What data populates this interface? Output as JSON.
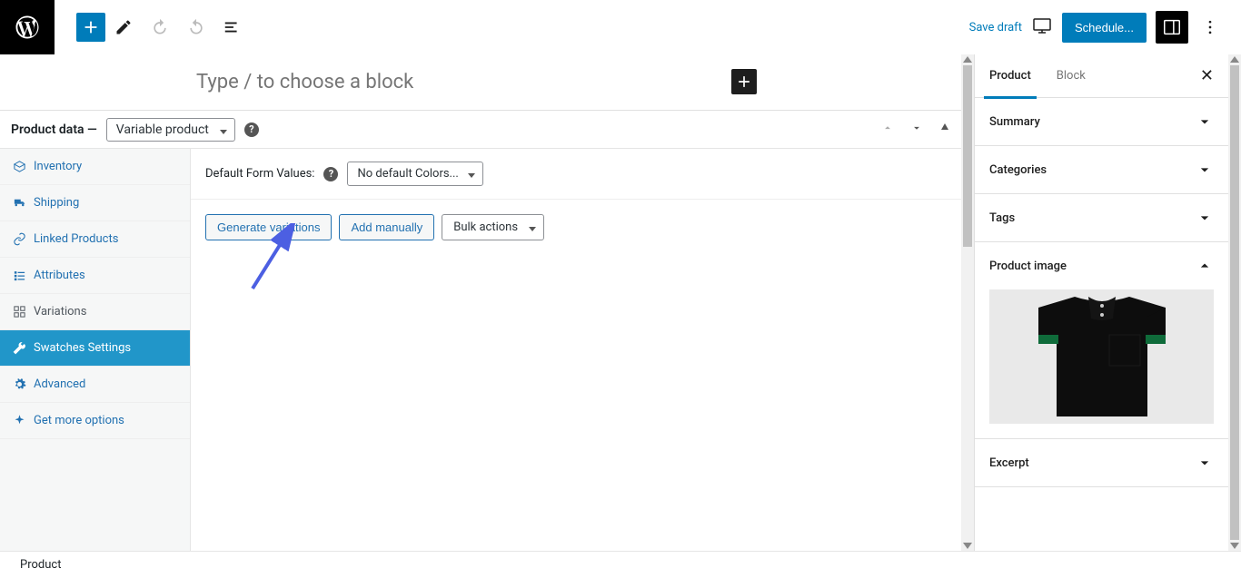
{
  "topbar": {
    "save_draft": "Save draft",
    "schedule": "Schedule..."
  },
  "editor": {
    "placeholder": "Type / to choose a block"
  },
  "product_data": {
    "label": "Product data —",
    "type_selected": "Variable product",
    "tabs": {
      "inventory": "Inventory",
      "shipping": "Shipping",
      "linked": "Linked Products",
      "attributes": "Attributes",
      "variations": "Variations",
      "swatches": "Swatches Settings",
      "advanced": "Advanced",
      "more": "Get more options"
    },
    "default_form_label": "Default Form Values:",
    "default_form_select": "No default Colors...",
    "buttons": {
      "generate": "Generate variations",
      "add_manual": "Add manually",
      "bulk": "Bulk actions"
    }
  },
  "sidebar": {
    "tabs": {
      "product": "Product",
      "block": "Block"
    },
    "panels": {
      "summary": "Summary",
      "categories": "Categories",
      "tags": "Tags",
      "product_image": "Product image",
      "excerpt": "Excerpt"
    }
  },
  "footer": {
    "breadcrumb": "Product"
  }
}
